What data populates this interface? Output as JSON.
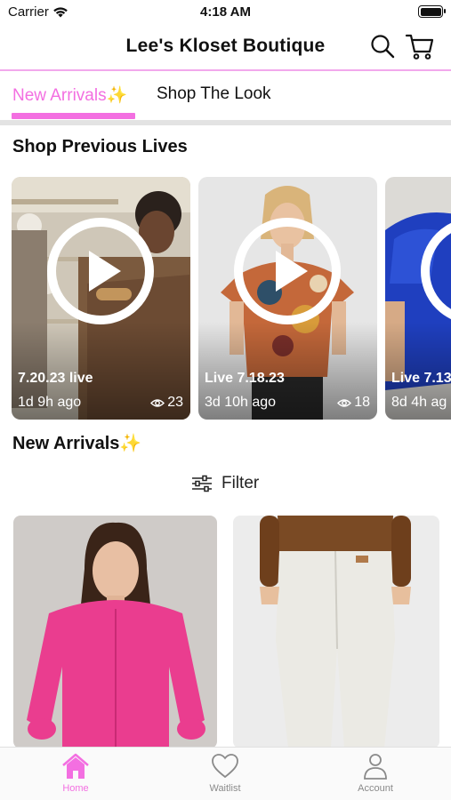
{
  "status_bar": {
    "carrier": "Carrier",
    "time": "4:18 AM"
  },
  "header": {
    "title": "Lee's Kloset Boutique",
    "icons": [
      "search-icon",
      "cart-icon"
    ]
  },
  "tabs": [
    {
      "label": "New Arrivals✨",
      "active": true
    },
    {
      "label": "Shop The Look",
      "active": false
    }
  ],
  "colors": {
    "accent": "#f36fe1",
    "accent_line": "#f2a9ec"
  },
  "previous_lives": {
    "title": "Shop Previous Lives",
    "items": [
      {
        "title": "7.20.23 live",
        "age": "1d 9h ago",
        "views": "23"
      },
      {
        "title": "Live 7.18.23",
        "age": "3d 10h ago",
        "views": "18"
      },
      {
        "title": "Live 7.13",
        "age": "8d 4h ag",
        "views": ""
      }
    ]
  },
  "new_arrivals": {
    "title": "New Arrivals✨",
    "filter_label": "Filter"
  },
  "tabbar": [
    {
      "label": "Home",
      "icon": "home-icon",
      "active": true
    },
    {
      "label": "Waitlist",
      "icon": "heart-icon",
      "active": false
    },
    {
      "label": "Account",
      "icon": "person-icon",
      "active": false
    }
  ]
}
